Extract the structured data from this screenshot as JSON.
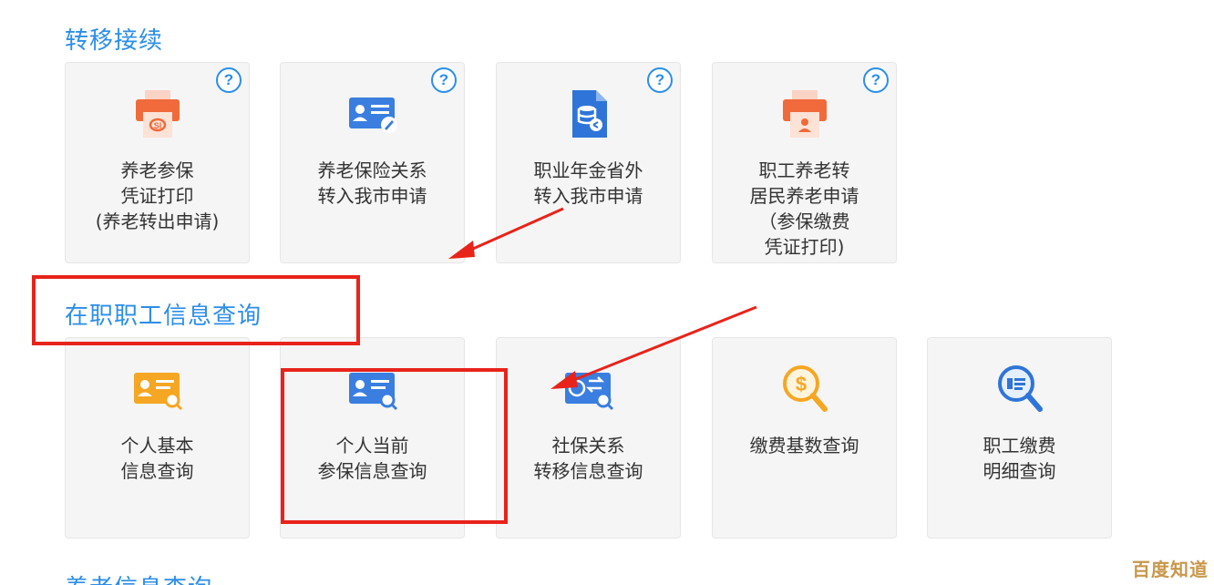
{
  "sections": [
    {
      "title": "转移接续",
      "cards": [
        {
          "lines": [
            "养老参保",
            "凭证打印",
            "(养老转出申请)"
          ],
          "icon": "printer-icon",
          "help": "?"
        },
        {
          "lines": [
            "养老保险关系",
            "转入我市申请"
          ],
          "icon": "id-card-edit-icon",
          "help": "?"
        },
        {
          "lines": [
            "职业年金省外",
            "转入我市申请"
          ],
          "icon": "database-document-icon",
          "help": "?"
        },
        {
          "lines": [
            "职工养老转",
            "居民养老申请",
            "（参保缴费",
            "凭证打印)"
          ],
          "icon": "printer-user-icon",
          "help": "?"
        }
      ]
    },
    {
      "title": "在职职工信息查询",
      "cards": [
        {
          "lines": [
            "个人基本",
            "信息查询"
          ],
          "icon": "id-card-search-icon"
        },
        {
          "lines": [
            "个人当前",
            "参保信息查询"
          ],
          "icon": "id-card-search-blue-icon"
        },
        {
          "lines": [
            "社保关系",
            "转移信息查询"
          ],
          "icon": "transfer-search-icon"
        },
        {
          "lines": [
            "缴费基数查询"
          ],
          "icon": "dollar-search-icon"
        },
        {
          "lines": [
            "职工缴费",
            "明细查询"
          ],
          "icon": "detail-search-icon"
        }
      ]
    },
    {
      "title": "养老信息查询"
    }
  ],
  "watermark": "百度知道",
  "colors": {
    "accent": "#2b8ee8",
    "orange": "#f06a3c",
    "amber": "#f5a623",
    "annotation": "#e8231b"
  }
}
